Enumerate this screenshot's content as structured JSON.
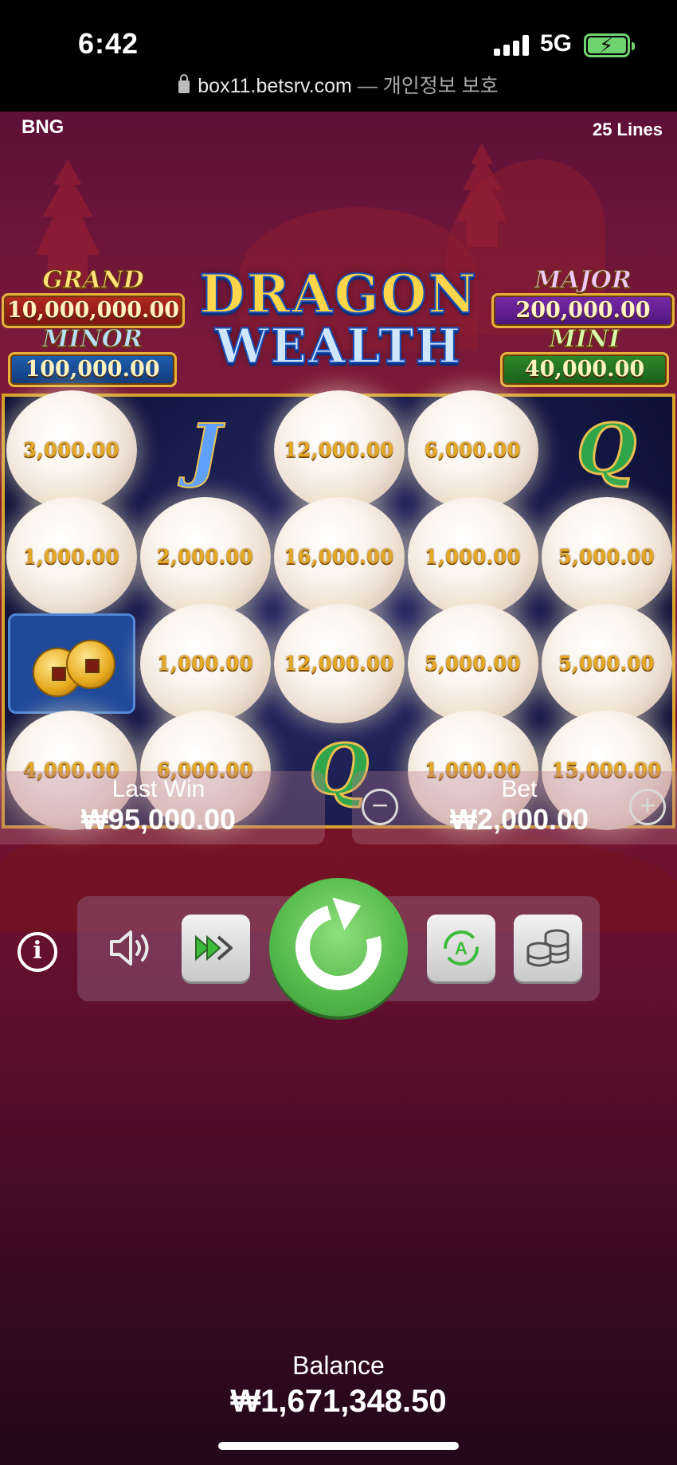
{
  "status_bar": {
    "time": "6:42",
    "network": "5G",
    "url": "box11.betsrv.com",
    "url_suffix": "— 개인정보 보호"
  },
  "game": {
    "provider": "BNG",
    "lines": "25 Lines",
    "logo_line1": "DRAGON",
    "logo_line2": "WEALTH"
  },
  "jackpots": {
    "grand": {
      "label": "GRAND",
      "value": "10,000,000.00"
    },
    "minor": {
      "label": "MINOR",
      "value": "100,000.00"
    },
    "major": {
      "label": "MAJOR",
      "value": "200,000.00"
    },
    "mini": {
      "label": "MINI",
      "value": "40,000.00"
    }
  },
  "reels": [
    [
      "3,000.00",
      "J",
      "12,000.00",
      "6,000.00",
      "Q"
    ],
    [
      "1,000.00",
      "2,000.00",
      "16,000.00",
      "1,000.00",
      "5,000.00"
    ],
    [
      "coins",
      "1,000.00",
      "12,000.00",
      "5,000.00",
      "5,000.00"
    ],
    [
      "4,000.00",
      "6,000.00",
      "Q",
      "1,000.00",
      "15,000.00"
    ]
  ],
  "last_win": {
    "label": "Last Win",
    "value": "₩95,000.00"
  },
  "bet": {
    "label": "Bet",
    "value": "₩2,000.00",
    "minus": "−",
    "plus": "+"
  },
  "controls": {
    "info": "i",
    "autoplay_letter": "A"
  },
  "balance": {
    "label": "Balance",
    "value": "₩1,671,348.50"
  }
}
